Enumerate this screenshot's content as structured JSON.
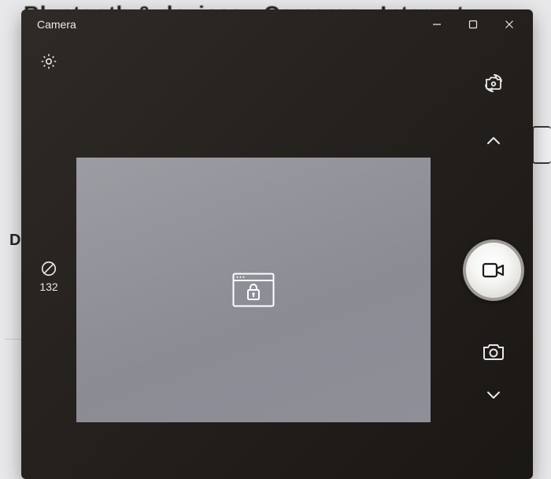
{
  "background": {
    "breadcrumb_partial": "Bluetooth & devices  ›  Cameras  ›  Integrat",
    "left_char": "D"
  },
  "window": {
    "title": "Camera"
  },
  "left": {
    "exposure_value": "132"
  }
}
